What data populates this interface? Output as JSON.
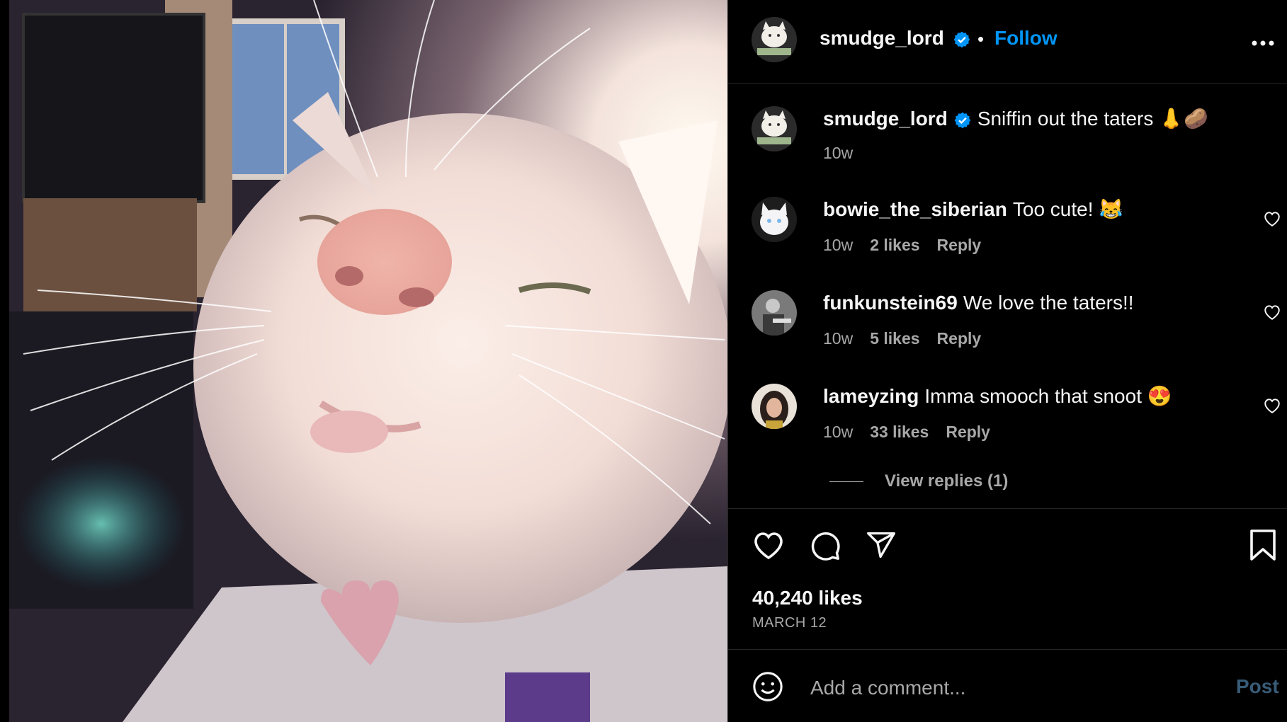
{
  "header": {
    "username": "smudge_lord",
    "separator": "•",
    "follow_label": "Follow",
    "more_label": "•••"
  },
  "caption": {
    "username": "smudge_lord",
    "text": "Sniffin out the taters 👃🥔",
    "time": "10w"
  },
  "comments": [
    {
      "username": "bowie_the_siberian",
      "text": "Too cute! 😹",
      "time": "10w",
      "likes": "2 likes",
      "reply": "Reply"
    },
    {
      "username": "funkunstein69",
      "text": "We love the taters!!",
      "time": "10w",
      "likes": "5 likes",
      "reply": "Reply"
    },
    {
      "username": "lameyzing",
      "text": "Imma smooch that snoot 😍",
      "time": "10w",
      "likes": "33 likes",
      "reply": "Reply"
    }
  ],
  "view_replies": "View replies (1)",
  "likes_count": "40,240 likes",
  "date": "MARCH 12",
  "add_comment": {
    "placeholder": "Add a comment...",
    "post_label": "Post"
  },
  "icons": [
    "heart-icon",
    "comment-icon",
    "share-icon",
    "bookmark-icon",
    "emoji-icon",
    "verified-icon",
    "more-icon"
  ],
  "colors": {
    "accent": "#0095f6",
    "verified": "#0095f6",
    "background": "#000000",
    "muted": "#a8a8a8",
    "post_disabled": "#385c78"
  }
}
